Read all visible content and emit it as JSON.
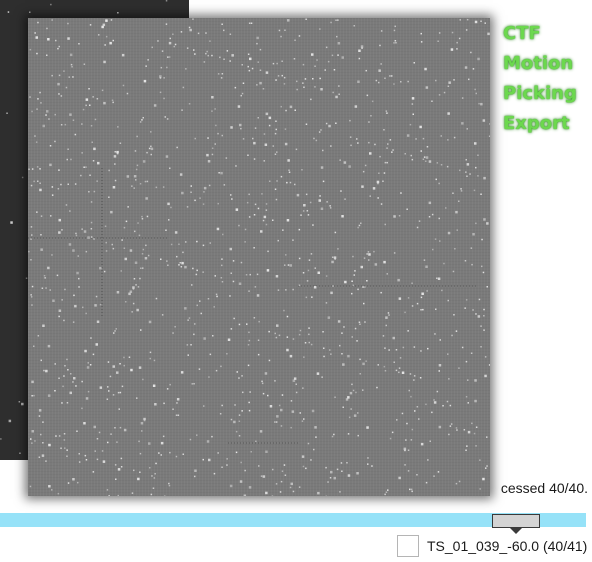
{
  "menu": {
    "items": [
      "CTF",
      "Motion",
      "Picking",
      "Export"
    ]
  },
  "status": {
    "text": "cessed 40/40."
  },
  "progress": {
    "value": 1.0
  },
  "tilt": {
    "label": "TS_01_039_-60.0 (40/41)",
    "checked": false
  },
  "colors": {
    "menu_text": "#6cd84e",
    "progress_bar": "#96e2f8",
    "image_background": "#7a7a7a",
    "background_image": "#2e2e2e"
  },
  "icons": {
    "slider": "slider-thumb-icon"
  }
}
